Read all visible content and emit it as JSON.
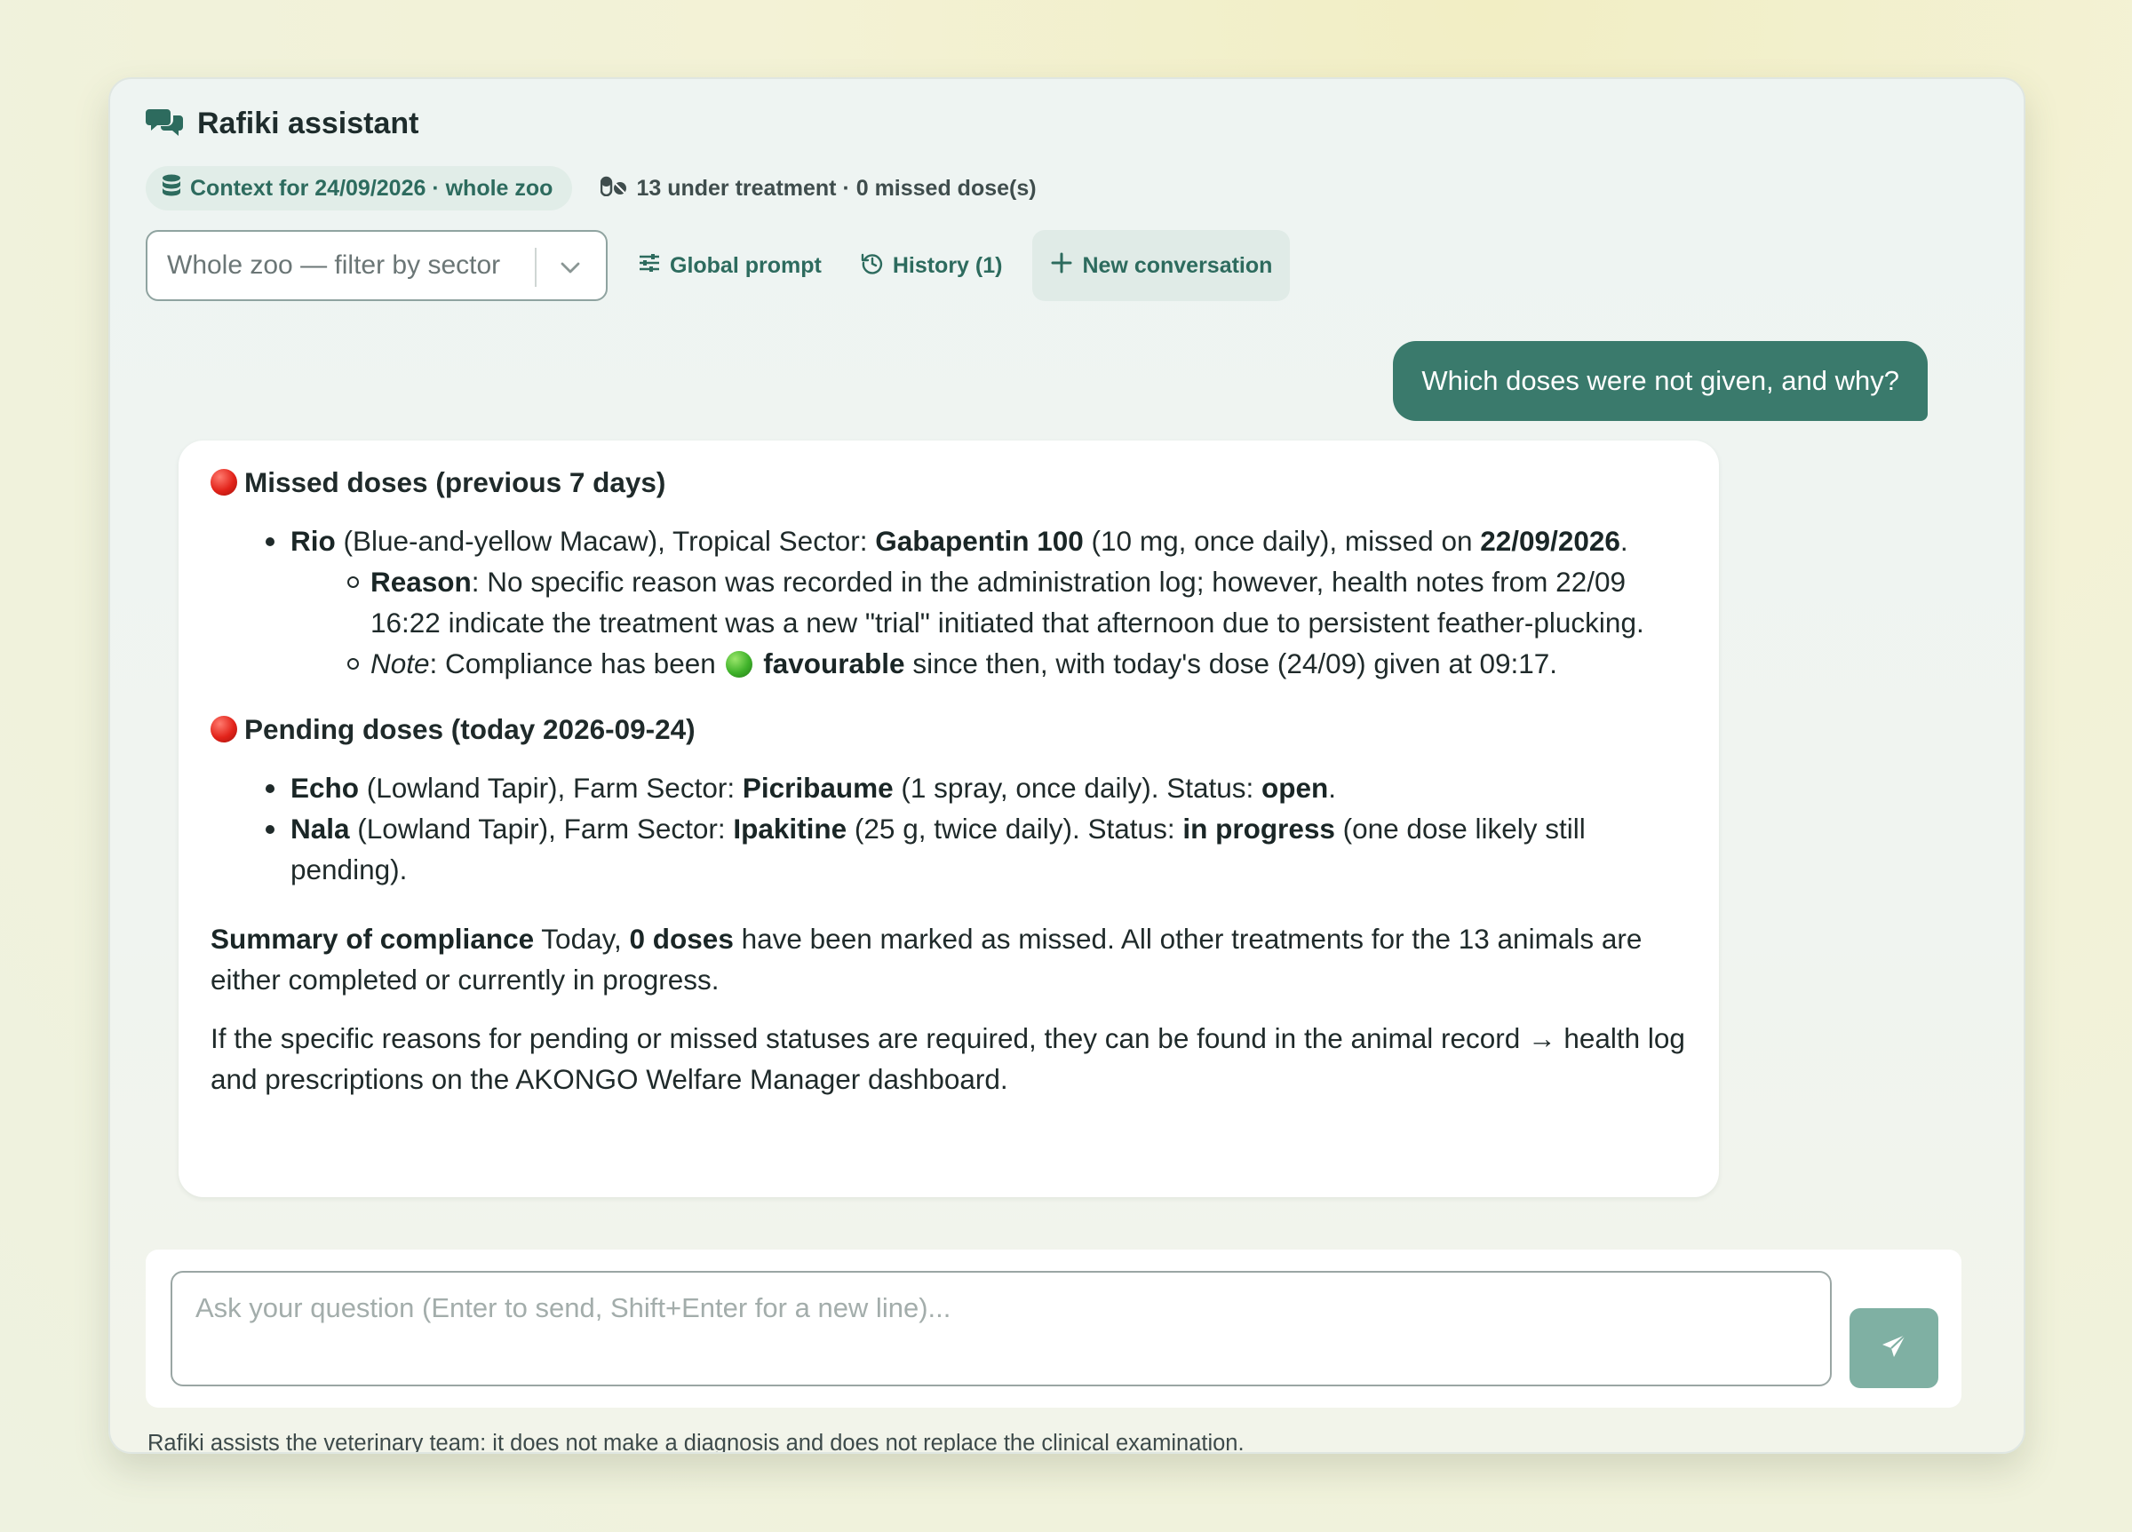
{
  "app": {
    "title": "Rafiki assistant",
    "context_chip": "Context for 24/09/2026 · whole zoo",
    "treatment_summary": "13 under treatment · 0 missed dose(s)"
  },
  "toolbar": {
    "sector_select_value": "Whole zoo — filter by sector",
    "global_prompt_label": "Global prompt",
    "history_label": "History (1)",
    "new_conversation_label": "New conversation"
  },
  "conversation": {
    "user_message": "Which doses were not given, and why?",
    "assistant": {
      "missed_heading": "Missed doses (previous 7 days)",
      "missed_item": {
        "animal": "Rio",
        "species_sector": " (Blue-and-yellow Macaw), Tropical Sector: ",
        "drug": "Gabapentin 100",
        "dosage": " (10 mg, once daily), missed on ",
        "date": "22/09/2026",
        "end": ".",
        "reason_label": "Reason",
        "reason_text": ": No specific reason was recorded in the administration log; however, health notes from 22/09 16:22 indicate the treatment was a new \"trial\" initiated that afternoon due to persistent feather-plucking.",
        "note_label": "Note",
        "note_text_a": ": Compliance has been ",
        "note_status": "favourable",
        "note_text_b": " since then, with today's dose (24/09) given at 09:17."
      },
      "pending_heading": "Pending doses (today 2026-09-24)",
      "pending_items": [
        {
          "animal": "Echo",
          "species_sector": " (Lowland Tapir), Farm Sector: ",
          "drug": "Picribaume",
          "dosage": " (1 spray, once daily). Status: ",
          "status": "open",
          "end": "."
        },
        {
          "animal": "Nala",
          "species_sector": " (Lowland Tapir), Farm Sector: ",
          "drug": "Ipakitine",
          "dosage": " (25 g, twice daily). Status: ",
          "status": "in progress",
          "end": " (one dose likely still pending)."
        }
      ],
      "summary_label": "Summary of compliance",
      "summary_text_a": " Today, ",
      "summary_count": "0 doses",
      "summary_text_b": " have been marked as missed. All other treatments for the 13 animals are either completed or currently in progress.",
      "closing_text": "If the specific reasons for pending or missed statuses are required, they can be found in the animal record → health log and prescriptions on the AKONGO Welfare Manager dashboard."
    }
  },
  "composer": {
    "placeholder": "Ask your question (Enter to send, Shift+Enter for a new line)...",
    "value": ""
  },
  "footer": {
    "disclaimer": "Rafiki assists the veterinary team: it does not make a diagnosis and does not replace the clinical examination."
  },
  "colors": {
    "accent": "#3a7a6c",
    "accent_text": "#2d6b5e",
    "send_button": "#7fb0a3",
    "missed_dot": "#e2231a",
    "favourable_dot": "#3fb22a"
  },
  "icons": {
    "title": "chat-bubbles-icon",
    "context": "database-icon",
    "treatment": "pills-icon",
    "select": "chevron-down-icon",
    "global_prompt": "sliders-icon",
    "history": "history-icon",
    "new_conversation": "plus-icon",
    "send": "paper-plane-icon"
  }
}
